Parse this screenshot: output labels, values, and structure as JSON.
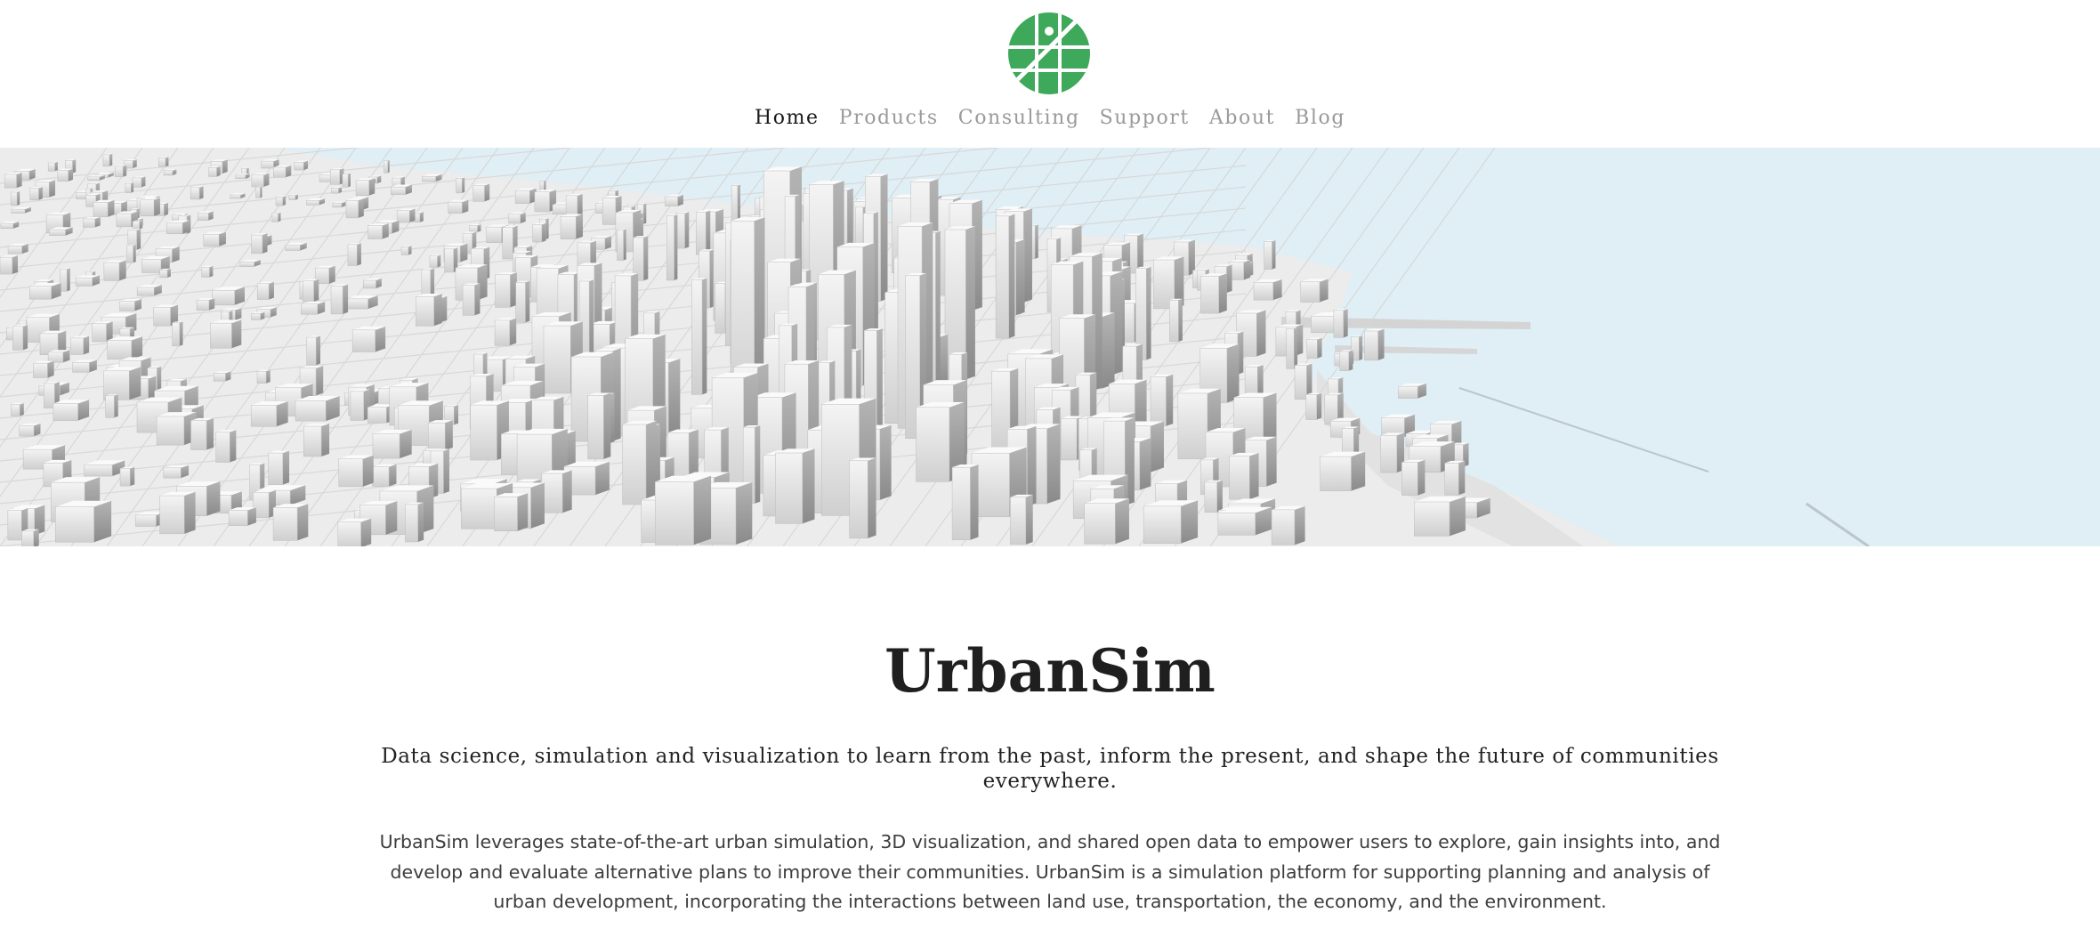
{
  "brand": {
    "logo_icon": "urbansim-globe-logo-icon",
    "logo_color": "#3ea85b"
  },
  "nav": {
    "items": [
      {
        "label": "Home",
        "active": true
      },
      {
        "label": "Products",
        "active": false
      },
      {
        "label": "Consulting",
        "active": false
      },
      {
        "label": "Support",
        "active": false
      },
      {
        "label": "About",
        "active": false
      },
      {
        "label": "Blog",
        "active": false
      }
    ]
  },
  "hero": {
    "image_icon": "city-skyline-3d-image",
    "water_color": "#dfeff5"
  },
  "main": {
    "title": "UrbanSim",
    "tagline": "Data science, simulation and visualization to learn from the past, inform the present, and shape the future of communities everywhere.",
    "description": "UrbanSim leverages state-of-the-art urban simulation, 3D visualization, and shared open data to empower users to explore, gain insights into, and develop and evaluate alternative plans to improve their communities. UrbanSim is a simulation platform for supporting planning and analysis of urban development, incorporating the interactions between land use, transportation, the economy, and the environment."
  }
}
